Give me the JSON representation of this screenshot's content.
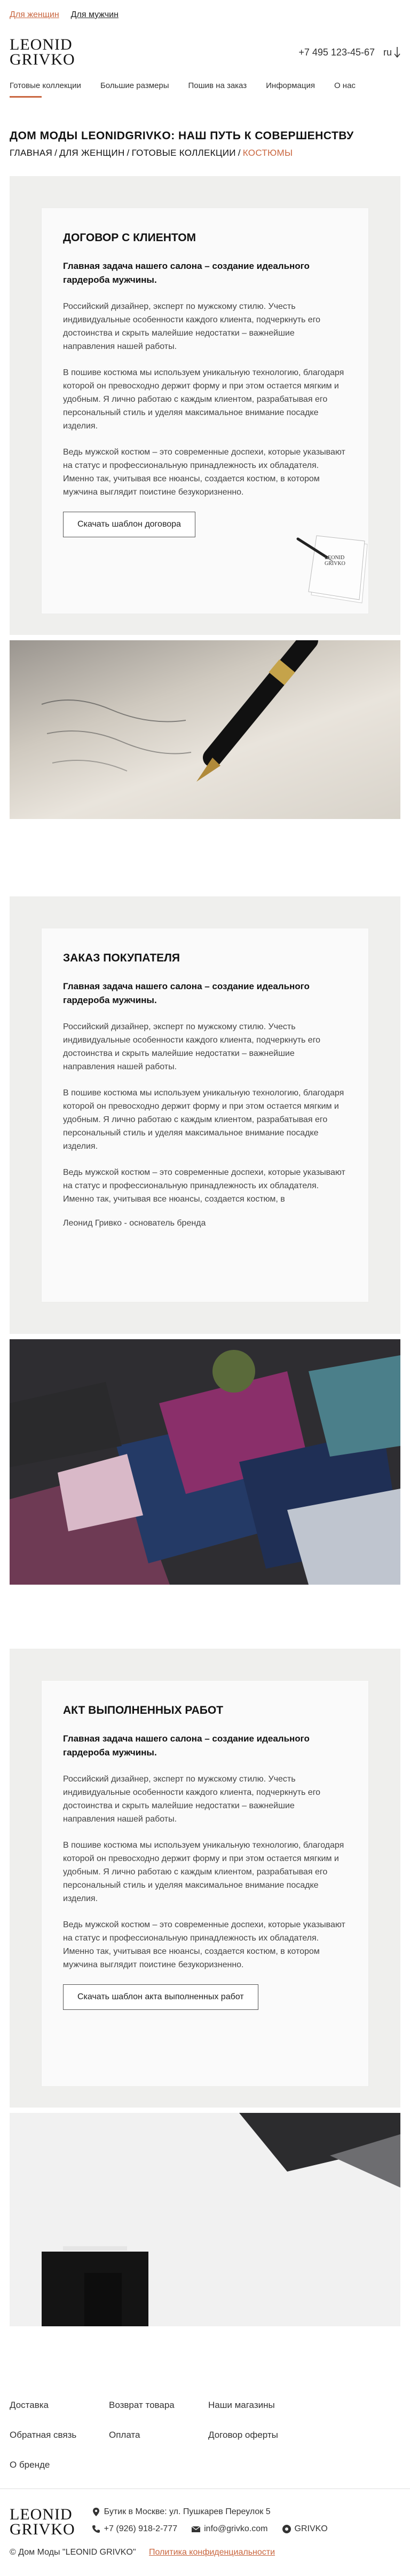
{
  "topbar": {
    "women": "Для женщин",
    "men": "Для мужчин"
  },
  "header": {
    "logo_line1": "LEONID",
    "logo_line2": "GRIVKO",
    "phone": "+7 495 123-45-67",
    "lang": "ru"
  },
  "nav": [
    "Готовые коллекции",
    "Большие размеры",
    "Пошив на заказ",
    "Информация",
    "О нас"
  ],
  "page_title": "ДОМ МОДЫ LEONIDGRIVKO: НАШ ПУТЬ К СОВЕРШЕНСТВУ",
  "breadcrumb": [
    "ГЛАВНАЯ",
    "ДЛЯ ЖЕНЩИН",
    "ГОТОВЫЕ КОЛЛЕКЦИИ",
    "КОСТЮМЫ"
  ],
  "breadcrumb_sep": "/",
  "sections": [
    {
      "title": "ДОГОВОР С КЛИЕНТОМ",
      "lead": "Главная задача нашего салона – создание идеального гардероба мужчины.",
      "p1": "Российский дизайнер, эксперт по мужскому стилю. Учесть индивидуальные особенности каждого клиента, подчеркнуть его достоинства и скрыть малейшие недостатки – важнейшие направления нашей работы.",
      "p2": "В пошиве костюма мы используем уникальную технологию, благодаря которой он превосходно держит форму и при этом остается мягким и удобным. Я лично работаю с каждым клиентом, разрабатывая его персональный стиль и уделяя максимальное внимание посадке изделия.",
      "p3": "Ведь мужской костюм – это современные доспехи, которые указывают на статус и профессиональную принадлежность их обладателя. Именно так, учитывая все нюансы, создается костюм, в котором мужчина выглядит поистине безукоризненно.",
      "button": "Скачать шаблон договора",
      "doc_label": "LEONID GRIVKO"
    },
    {
      "title": "ЗАКАЗ ПОКУПАТЕЛЯ",
      "lead": "Главная задача нашего салона – создание идеального гардероба мужчины.",
      "p1": "Российский дизайнер, эксперт по мужскому стилю. Учесть индивидуальные особенности каждого клиента, подчеркнуть его достоинства и скрыть малейшие недостатки – важнейшие направления нашей работы.",
      "p2": "В пошиве костюма мы используем уникальную технологию, благодаря которой он превосходно держит форму и при этом остается мягким и удобным. Я лично работаю с каждым клиентом, разрабатывая его персональный стиль и уделяя максимальное внимание посадке изделия.",
      "p3": "Ведь мужской костюм – это современные доспехи, которые указывают на статус и профессиональную принадлежность их обладателя. Именно так, учитывая все нюансы, создается костюм, в",
      "author": "Леонид Гривко - основатель бренда"
    },
    {
      "title": "АКТ ВЫПОЛНЕННЫХ РАБОТ",
      "lead": "Главная задача нашего салона – создание идеального гардероба мужчины.",
      "p1": "Российский дизайнер, эксперт по мужскому стилю. Учесть индивидуальные особенности каждого клиента, подчеркнуть его достоинства и скрыть малейшие недостатки – важнейшие направления нашей работы.",
      "p2": "В пошиве костюма мы используем уникальную технологию, благодаря которой он превосходно держит форму и при этом остается мягким и удобным. Я лично работаю с каждым клиентом, разрабатывая его персональный стиль и уделяя максимальное внимание посадке изделия.",
      "p3": "Ведь мужской костюм – это современные доспехи, которые указывают на статус и профессиональную принадлежность их обладателя. Именно так, учитывая все нюансы, создается костюм, в котором мужчина выглядит поистине безукоризненно.",
      "button": "Скачать шаблон акта выполненных работ"
    }
  ],
  "footer": {
    "links": [
      "Доставка",
      "Возврат товара",
      "Наши магазины",
      "Обратная связь",
      "Оплата",
      "Договор оферты",
      "О бренде"
    ],
    "logo_line1": "LEONID",
    "logo_line2": "GRIVKO",
    "address": "Бутик в Москве: ул. Пушкарев Переулок 5",
    "phone": "+7 (926) 918-2-777",
    "email": "info@grivko.com",
    "brand": "GRIVKO",
    "copyright": "© Дом Моды \"LEONID GRIVKO\"",
    "privacy": "Политика конфиденциальности"
  },
  "colors": {
    "accent": "#c9663f",
    "section_bg": "#efefed",
    "card_bg": "#fafafa"
  }
}
